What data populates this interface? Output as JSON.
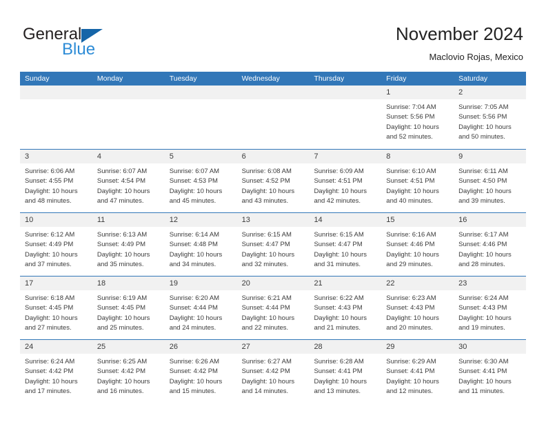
{
  "brand": {
    "name_top": "General",
    "name_bottom": "Blue",
    "triangle_color": "#1565a8",
    "blue_text_color": "#2c8bd6"
  },
  "header": {
    "title": "November 2024",
    "subtitle": "Maclovio Rojas, Mexico"
  },
  "theme": {
    "header_blue": "#3277b8",
    "daynum_band": "#f1f1f1",
    "text": "#3a3a3a"
  },
  "weekdays": [
    "Sunday",
    "Monday",
    "Tuesday",
    "Wednesday",
    "Thursday",
    "Friday",
    "Saturday"
  ],
  "weeks": [
    [
      {
        "day": "",
        "sunrise": "",
        "sunset": "",
        "daylight_line1": "",
        "daylight_line2": ""
      },
      {
        "day": "",
        "sunrise": "",
        "sunset": "",
        "daylight_line1": "",
        "daylight_line2": ""
      },
      {
        "day": "",
        "sunrise": "",
        "sunset": "",
        "daylight_line1": "",
        "daylight_line2": ""
      },
      {
        "day": "",
        "sunrise": "",
        "sunset": "",
        "daylight_line1": "",
        "daylight_line2": ""
      },
      {
        "day": "",
        "sunrise": "",
        "sunset": "",
        "daylight_line1": "",
        "daylight_line2": ""
      },
      {
        "day": "1",
        "sunrise": "Sunrise: 7:04 AM",
        "sunset": "Sunset: 5:56 PM",
        "daylight_line1": "Daylight: 10 hours",
        "daylight_line2": "and 52 minutes."
      },
      {
        "day": "2",
        "sunrise": "Sunrise: 7:05 AM",
        "sunset": "Sunset: 5:56 PM",
        "daylight_line1": "Daylight: 10 hours",
        "daylight_line2": "and 50 minutes."
      }
    ],
    [
      {
        "day": "3",
        "sunrise": "Sunrise: 6:06 AM",
        "sunset": "Sunset: 4:55 PM",
        "daylight_line1": "Daylight: 10 hours",
        "daylight_line2": "and 48 minutes."
      },
      {
        "day": "4",
        "sunrise": "Sunrise: 6:07 AM",
        "sunset": "Sunset: 4:54 PM",
        "daylight_line1": "Daylight: 10 hours",
        "daylight_line2": "and 47 minutes."
      },
      {
        "day": "5",
        "sunrise": "Sunrise: 6:07 AM",
        "sunset": "Sunset: 4:53 PM",
        "daylight_line1": "Daylight: 10 hours",
        "daylight_line2": "and 45 minutes."
      },
      {
        "day": "6",
        "sunrise": "Sunrise: 6:08 AM",
        "sunset": "Sunset: 4:52 PM",
        "daylight_line1": "Daylight: 10 hours",
        "daylight_line2": "and 43 minutes."
      },
      {
        "day": "7",
        "sunrise": "Sunrise: 6:09 AM",
        "sunset": "Sunset: 4:51 PM",
        "daylight_line1": "Daylight: 10 hours",
        "daylight_line2": "and 42 minutes."
      },
      {
        "day": "8",
        "sunrise": "Sunrise: 6:10 AM",
        "sunset": "Sunset: 4:51 PM",
        "daylight_line1": "Daylight: 10 hours",
        "daylight_line2": "and 40 minutes."
      },
      {
        "day": "9",
        "sunrise": "Sunrise: 6:11 AM",
        "sunset": "Sunset: 4:50 PM",
        "daylight_line1": "Daylight: 10 hours",
        "daylight_line2": "and 39 minutes."
      }
    ],
    [
      {
        "day": "10",
        "sunrise": "Sunrise: 6:12 AM",
        "sunset": "Sunset: 4:49 PM",
        "daylight_line1": "Daylight: 10 hours",
        "daylight_line2": "and 37 minutes."
      },
      {
        "day": "11",
        "sunrise": "Sunrise: 6:13 AM",
        "sunset": "Sunset: 4:49 PM",
        "daylight_line1": "Daylight: 10 hours",
        "daylight_line2": "and 35 minutes."
      },
      {
        "day": "12",
        "sunrise": "Sunrise: 6:14 AM",
        "sunset": "Sunset: 4:48 PM",
        "daylight_line1": "Daylight: 10 hours",
        "daylight_line2": "and 34 minutes."
      },
      {
        "day": "13",
        "sunrise": "Sunrise: 6:15 AM",
        "sunset": "Sunset: 4:47 PM",
        "daylight_line1": "Daylight: 10 hours",
        "daylight_line2": "and 32 minutes."
      },
      {
        "day": "14",
        "sunrise": "Sunrise: 6:15 AM",
        "sunset": "Sunset: 4:47 PM",
        "daylight_line1": "Daylight: 10 hours",
        "daylight_line2": "and 31 minutes."
      },
      {
        "day": "15",
        "sunrise": "Sunrise: 6:16 AM",
        "sunset": "Sunset: 4:46 PM",
        "daylight_line1": "Daylight: 10 hours",
        "daylight_line2": "and 29 minutes."
      },
      {
        "day": "16",
        "sunrise": "Sunrise: 6:17 AM",
        "sunset": "Sunset: 4:46 PM",
        "daylight_line1": "Daylight: 10 hours",
        "daylight_line2": "and 28 minutes."
      }
    ],
    [
      {
        "day": "17",
        "sunrise": "Sunrise: 6:18 AM",
        "sunset": "Sunset: 4:45 PM",
        "daylight_line1": "Daylight: 10 hours",
        "daylight_line2": "and 27 minutes."
      },
      {
        "day": "18",
        "sunrise": "Sunrise: 6:19 AM",
        "sunset": "Sunset: 4:45 PM",
        "daylight_line1": "Daylight: 10 hours",
        "daylight_line2": "and 25 minutes."
      },
      {
        "day": "19",
        "sunrise": "Sunrise: 6:20 AM",
        "sunset": "Sunset: 4:44 PM",
        "daylight_line1": "Daylight: 10 hours",
        "daylight_line2": "and 24 minutes."
      },
      {
        "day": "20",
        "sunrise": "Sunrise: 6:21 AM",
        "sunset": "Sunset: 4:44 PM",
        "daylight_line1": "Daylight: 10 hours",
        "daylight_line2": "and 22 minutes."
      },
      {
        "day": "21",
        "sunrise": "Sunrise: 6:22 AM",
        "sunset": "Sunset: 4:43 PM",
        "daylight_line1": "Daylight: 10 hours",
        "daylight_line2": "and 21 minutes."
      },
      {
        "day": "22",
        "sunrise": "Sunrise: 6:23 AM",
        "sunset": "Sunset: 4:43 PM",
        "daylight_line1": "Daylight: 10 hours",
        "daylight_line2": "and 20 minutes."
      },
      {
        "day": "23",
        "sunrise": "Sunrise: 6:24 AM",
        "sunset": "Sunset: 4:43 PM",
        "daylight_line1": "Daylight: 10 hours",
        "daylight_line2": "and 19 minutes."
      }
    ],
    [
      {
        "day": "24",
        "sunrise": "Sunrise: 6:24 AM",
        "sunset": "Sunset: 4:42 PM",
        "daylight_line1": "Daylight: 10 hours",
        "daylight_line2": "and 17 minutes."
      },
      {
        "day": "25",
        "sunrise": "Sunrise: 6:25 AM",
        "sunset": "Sunset: 4:42 PM",
        "daylight_line1": "Daylight: 10 hours",
        "daylight_line2": "and 16 minutes."
      },
      {
        "day": "26",
        "sunrise": "Sunrise: 6:26 AM",
        "sunset": "Sunset: 4:42 PM",
        "daylight_line1": "Daylight: 10 hours",
        "daylight_line2": "and 15 minutes."
      },
      {
        "day": "27",
        "sunrise": "Sunrise: 6:27 AM",
        "sunset": "Sunset: 4:42 PM",
        "daylight_line1": "Daylight: 10 hours",
        "daylight_line2": "and 14 minutes."
      },
      {
        "day": "28",
        "sunrise": "Sunrise: 6:28 AM",
        "sunset": "Sunset: 4:41 PM",
        "daylight_line1": "Daylight: 10 hours",
        "daylight_line2": "and 13 minutes."
      },
      {
        "day": "29",
        "sunrise": "Sunrise: 6:29 AM",
        "sunset": "Sunset: 4:41 PM",
        "daylight_line1": "Daylight: 10 hours",
        "daylight_line2": "and 12 minutes."
      },
      {
        "day": "30",
        "sunrise": "Sunrise: 6:30 AM",
        "sunset": "Sunset: 4:41 PM",
        "daylight_line1": "Daylight: 10 hours",
        "daylight_line2": "and 11 minutes."
      }
    ]
  ]
}
